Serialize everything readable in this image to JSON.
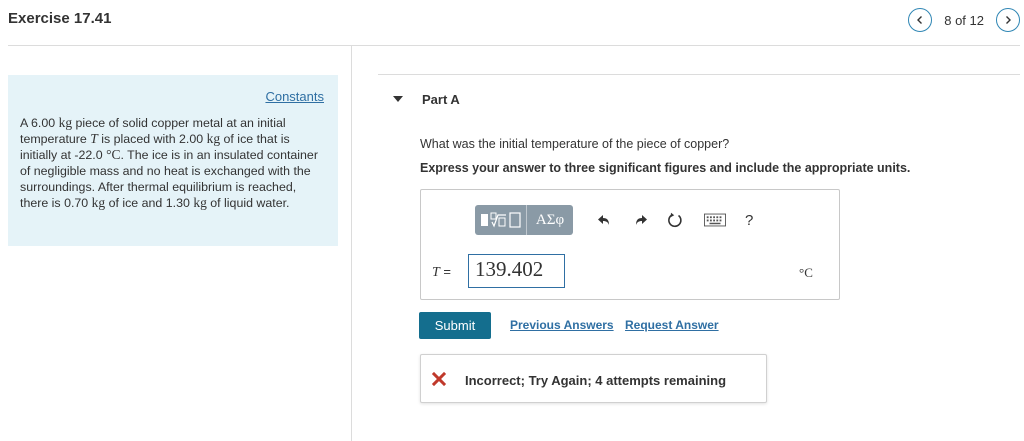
{
  "header": {
    "title": "Exercise 17.41",
    "pager_text": "8 of 12",
    "prev_icon": "chevron-left-icon",
    "next_icon": "chevron-right-icon"
  },
  "problem": {
    "constants_label": "Constants",
    "text_parts": {
      "p1": "A 6.00 ",
      "kg1": "kg",
      "p2": " piece of solid copper metal at an initial temperature ",
      "T": "T",
      "p3": " is placed with 2.00 ",
      "kg2": "kg",
      "p4": " of ice that is initially at -22.0 ",
      "degC": "°C",
      "p5": ". The ice is in an insulated container of negligible mass and no heat is exchanged with the surroundings. After thermal equilibrium is reached, there is 0.70 ",
      "kg3": "kg",
      "p6": " of ice and 1.30 ",
      "kg4": "kg",
      "p7": " of liquid water."
    }
  },
  "part": {
    "title": "Part A",
    "question": "What was the initial temperature of the piece of copper?",
    "instruction": "Express your answer to three significant figures and include the appropriate units."
  },
  "answer": {
    "variable": "T",
    "equals": "=",
    "value": "139.402",
    "unit": "°C",
    "toolbar": {
      "greek_label": "ΑΣφ",
      "help_label": "?",
      "icons": [
        "templates-icon",
        "greek-symbols-icon",
        "undo-icon",
        "redo-icon",
        "reset-icon",
        "keyboard-icon",
        "help-icon"
      ]
    }
  },
  "actions": {
    "submit": "Submit",
    "previous_answers": "Previous Answers",
    "request_answer": "Request Answer"
  },
  "feedback": {
    "icon": "x-icon",
    "text": "Incorrect; Try Again; 4 attempts remaining"
  },
  "colors": {
    "accent": "#146e8e",
    "link": "#2f6fa3",
    "panel_bg": "#e5f3f8",
    "error": "#c0392b",
    "toolbar_bg": "#8a9aa6"
  }
}
